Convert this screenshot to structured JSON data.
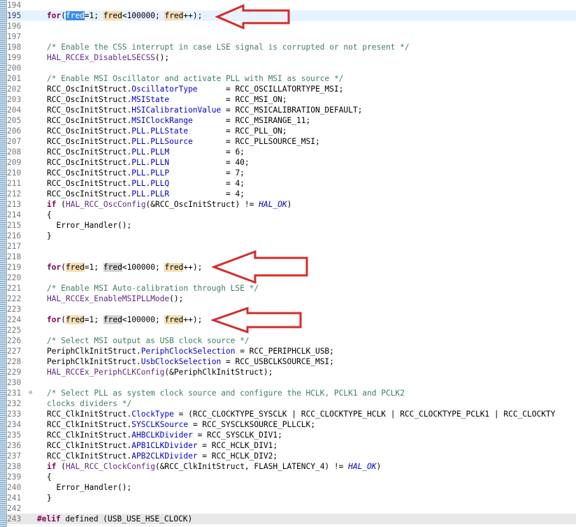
{
  "editor": {
    "lines": [
      {
        "n": "194",
        "type": "blank"
      },
      {
        "n": "195",
        "type": "for",
        "current": true,
        "selected": true
      },
      {
        "n": "196",
        "type": "blank"
      },
      {
        "n": "197",
        "type": "blank"
      },
      {
        "n": "198",
        "type": "comment",
        "text": "/* Enable the CSS interrupt in case LSE signal is corrupted or not present */"
      },
      {
        "n": "199",
        "type": "call",
        "fn": "HAL_RCCEx_DisableLSECSS",
        "rest": "();"
      },
      {
        "n": "200",
        "type": "blank"
      },
      {
        "n": "201",
        "type": "comment",
        "text": "/* Enable MSI Oscillator and activate PLL with MSI as source */"
      },
      {
        "n": "202",
        "type": "assign",
        "obj": "RCC_OscInitStruct.",
        "field": "OscillatorType",
        "pad": "      ",
        "val": "= RCC_OSCILLATORTYPE_MSI;"
      },
      {
        "n": "203",
        "type": "assign",
        "obj": "RCC_OscInitStruct.",
        "field": "MSIState",
        "pad": "            ",
        "val": "= RCC_MSI_ON;"
      },
      {
        "n": "204",
        "type": "assign",
        "obj": "RCC_OscInitStruct.",
        "field": "HSICalibrationValue",
        "pad": " ",
        "val": "= RCC_MSICALIBRATION_DEFAULT;"
      },
      {
        "n": "205",
        "type": "assign",
        "obj": "RCC_OscInitStruct.",
        "field": "MSIClockRange",
        "pad": "       ",
        "val": "= RCC_MSIRANGE_11;"
      },
      {
        "n": "206",
        "type": "assign",
        "obj": "RCC_OscInitStruct.",
        "field": "PLL.PLLState",
        "pad": "        ",
        "val": "= RCC_PLL_ON;"
      },
      {
        "n": "207",
        "type": "assign",
        "obj": "RCC_OscInitStruct.",
        "field": "PLL.PLLSource",
        "pad": "       ",
        "val": "= RCC_PLLSOURCE_MSI;"
      },
      {
        "n": "208",
        "type": "assign",
        "obj": "RCC_OscInitStruct.",
        "field": "PLL.PLLM",
        "pad": "            ",
        "val": "= 6;"
      },
      {
        "n": "209",
        "type": "assign",
        "obj": "RCC_OscInitStruct.",
        "field": "PLL.PLLN",
        "pad": "            ",
        "val": "= 40;"
      },
      {
        "n": "210",
        "type": "assign",
        "obj": "RCC_OscInitStruct.",
        "field": "PLL.PLLP",
        "pad": "            ",
        "val": "= 7;"
      },
      {
        "n": "211",
        "type": "assign",
        "obj": "RCC_OscInitStruct.",
        "field": "PLL.PLLQ",
        "pad": "            ",
        "val": "= 4;"
      },
      {
        "n": "212",
        "type": "assign",
        "obj": "RCC_OscInitStruct.",
        "field": "PLL.PLLR",
        "pad": "            ",
        "val": "= 4;"
      },
      {
        "n": "213",
        "type": "ifcall",
        "kw": "if",
        "pre": " (",
        "fn": "HAL_RCC_OscConfig",
        "mid": "(&RCC_OscInitStruct) != ",
        "it": "HAL_OK",
        "post": ")"
      },
      {
        "n": "214",
        "type": "plain",
        "text": "{"
      },
      {
        "n": "215",
        "type": "plain",
        "text": "  Error_Handler();"
      },
      {
        "n": "216",
        "type": "plain",
        "text": "}"
      },
      {
        "n": "217",
        "type": "blank"
      },
      {
        "n": "218",
        "type": "blank"
      },
      {
        "n": "219",
        "type": "for"
      },
      {
        "n": "220",
        "type": "blank"
      },
      {
        "n": "221",
        "type": "comment",
        "text": "/* Enable MSI Auto-calibration through LSE */"
      },
      {
        "n": "222",
        "type": "call",
        "fn": "HAL_RCCEx_EnableMSIPLLMode",
        "rest": "();"
      },
      {
        "n": "223",
        "type": "blank"
      },
      {
        "n": "224",
        "type": "for"
      },
      {
        "n": "225",
        "type": "blank"
      },
      {
        "n": "226",
        "type": "comment",
        "text": "/* Select MSI output as USB clock source */"
      },
      {
        "n": "227",
        "type": "assign",
        "obj": "PeriphClkInitStruct.",
        "field": "PeriphClockSelection",
        "pad": " ",
        "val": "= RCC_PERIPHCLK_USB;"
      },
      {
        "n": "228",
        "type": "assign",
        "obj": "PeriphClkInitStruct.",
        "field": "UsbClockSelection",
        "pad": " ",
        "val": "= RCC_USBCLKSOURCE_MSI;"
      },
      {
        "n": "229",
        "type": "call",
        "fn": "HAL_RCCEx_PeriphCLKConfig",
        "rest": "(&PeriphClkInitStruct);"
      },
      {
        "n": "230",
        "type": "blank"
      },
      {
        "n": "231",
        "type": "comment",
        "fold": "⊖",
        "text": "/* Select PLL as system clock source and configure the HCLK, PCLK1 and PCLK2"
      },
      {
        "n": "232",
        "type": "comment",
        "text": "clocks dividers */"
      },
      {
        "n": "233",
        "type": "assign",
        "obj": "RCC_ClkInitStruct.",
        "field": "ClockType",
        "pad": " ",
        "val": "= (RCC_CLOCKTYPE_SYSCLK | RCC_CLOCKTYPE_HCLK | RCC_CLOCKTYPE_PCLK1 | RCC_CLOCKTY"
      },
      {
        "n": "234",
        "type": "assign",
        "obj": "RCC_ClkInitStruct.",
        "field": "SYSCLKSource",
        "pad": " ",
        "val": "= RCC_SYSCLKSOURCE_PLLCLK;"
      },
      {
        "n": "235",
        "type": "assign",
        "obj": "RCC_ClkInitStruct.",
        "field": "AHBCLKDivider",
        "pad": " ",
        "val": "= RCC_SYSCLK_DIV1;"
      },
      {
        "n": "236",
        "type": "assign",
        "obj": "RCC_ClkInitStruct.",
        "field": "APB1CLKDivider",
        "pad": " ",
        "val": "= RCC_HCLK_DIV1;"
      },
      {
        "n": "237",
        "type": "assign",
        "obj": "RCC_ClkInitStruct.",
        "field": "APB2CLKDivider",
        "pad": " ",
        "val": "= RCC_HCLK_DIV2;"
      },
      {
        "n": "238",
        "type": "ifcall",
        "kw": "if",
        "pre": " (",
        "fn": "HAL_RCC_ClockConfig",
        "mid": "(&RCC_ClkInitStruct, FLASH_LATENCY_4) != ",
        "it": "HAL_OK",
        "post": ")"
      },
      {
        "n": "239",
        "type": "plain",
        "text": "{"
      },
      {
        "n": "240",
        "type": "plain",
        "text": "  Error_Handler();"
      },
      {
        "n": "241",
        "type": "plain",
        "text": "}"
      },
      {
        "n": "242",
        "type": "blank"
      },
      {
        "n": "243",
        "type": "directive",
        "kw": "#elif",
        "text": " defined (USB_USE_HSE_CLOCK)"
      }
    ],
    "for_tokens": {
      "kw": "for",
      "open": "(",
      "var": "fred",
      "init": "=1; ",
      "cond": "<100000; ",
      "inc": "++);"
    }
  },
  "annotations": {
    "arrow_color": "#d42b2b"
  }
}
